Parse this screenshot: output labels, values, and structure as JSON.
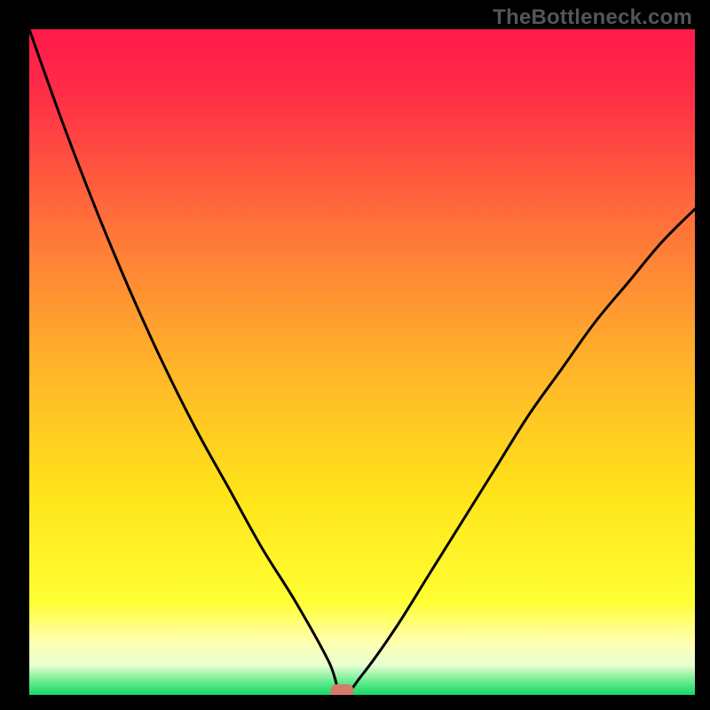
{
  "watermark": "TheBottleneck.com",
  "chart_data": {
    "type": "line",
    "title": "",
    "xlabel": "",
    "ylabel": "",
    "xlim": [
      0,
      100
    ],
    "ylim": [
      0,
      100
    ],
    "grid": false,
    "legend": false,
    "series": [
      {
        "name": "bottleneck-curve",
        "x": [
          0,
          5,
          10,
          15,
          20,
          25,
          30,
          35,
          40,
          45,
          47,
          50,
          55,
          60,
          65,
          70,
          75,
          80,
          85,
          90,
          95,
          100
        ],
        "values": [
          100,
          86,
          73,
          61,
          50,
          40,
          31,
          22,
          14,
          5,
          0,
          3,
          10,
          18,
          26,
          34,
          42,
          49,
          56,
          62,
          68,
          73
        ]
      }
    ],
    "marker": {
      "name": "min-point",
      "x": 47,
      "y": 0,
      "color": "#d67a6a"
    },
    "background_gradient": {
      "stops": [
        {
          "pos": 0.0,
          "color": "#ff1a4a"
        },
        {
          "pos": 0.1,
          "color": "#ff2e46"
        },
        {
          "pos": 0.3,
          "color": "#ff7439"
        },
        {
          "pos": 0.5,
          "color": "#ffb22a"
        },
        {
          "pos": 0.7,
          "color": "#ffe41a"
        },
        {
          "pos": 0.86,
          "color": "#ffff33"
        },
        {
          "pos": 0.92,
          "color": "#ffffb0"
        },
        {
          "pos": 0.955,
          "color": "#e8ffd0"
        },
        {
          "pos": 0.985,
          "color": "#4fe883"
        },
        {
          "pos": 1.0,
          "color": "#18d66b"
        }
      ]
    }
  }
}
